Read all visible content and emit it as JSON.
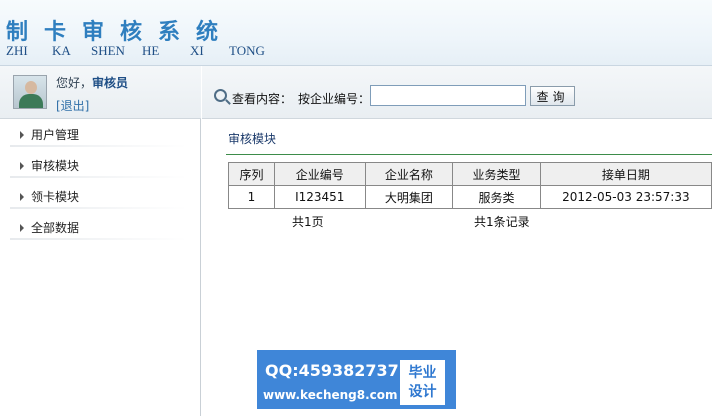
{
  "header": {
    "title_chars": [
      "制",
      "卡",
      "审",
      "核",
      "系",
      "统"
    ],
    "pinyin": [
      "ZHI",
      "KA",
      "SHEN",
      "HE",
      "XI",
      "TONG"
    ]
  },
  "user": {
    "greeting": "您好，",
    "role": "审核员",
    "logout": "[退出]"
  },
  "menu": {
    "items": [
      {
        "label": "用户管理"
      },
      {
        "label": "审核模块"
      },
      {
        "label": "领卡模块"
      },
      {
        "label": "全部数据"
      }
    ]
  },
  "search": {
    "label": "查看内容：",
    "by": "按企业编号：",
    "value": "",
    "button": "查询"
  },
  "main": {
    "section_title": "审核模块",
    "table": {
      "headers": [
        "序列",
        "企业编号",
        "企业名称",
        "业务类型",
        "接单日期"
      ],
      "rows": [
        [
          "1",
          "I123451",
          "大明集团",
          "服务类",
          "2012-05-03 23:57:33"
        ]
      ]
    },
    "pager": {
      "pages": "共1页",
      "records": "共1条记录"
    }
  },
  "watermark": {
    "qq": "QQ:459382737",
    "url": "www.kecheng8.com",
    "badge_line1": "毕业",
    "badge_line2": "设计"
  },
  "colors": {
    "title": "#2f7fbf",
    "accent_line": "#3d8c4a",
    "watermark_bg": "#3f86d8"
  }
}
